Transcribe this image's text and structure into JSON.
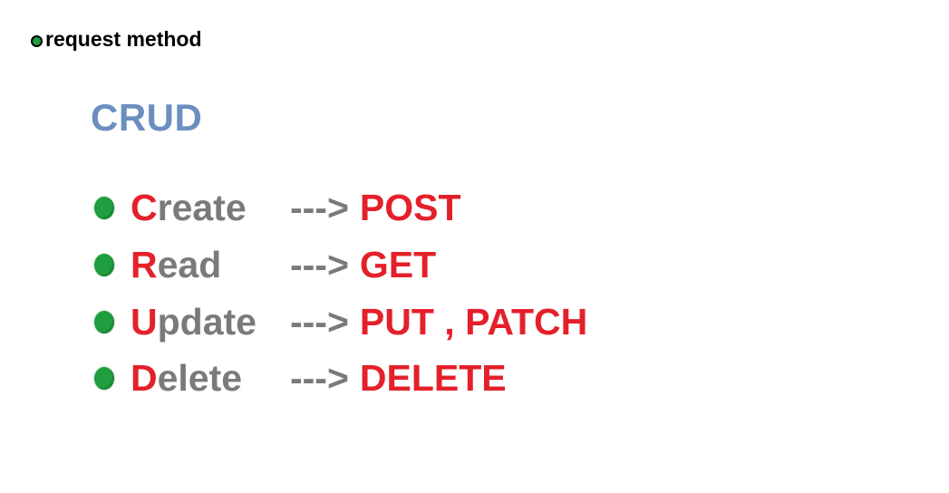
{
  "header": {
    "text": "request method"
  },
  "title": "CRUD",
  "colors": {
    "title": "#6b8fbf",
    "accent_red": "#e4202a",
    "text_gray": "#7a7a7a",
    "bullet_green": "#1f9e3f"
  },
  "rows": [
    {
      "initial": "C",
      "rest": "reate",
      "arrow": "--->",
      "method": "POST"
    },
    {
      "initial": "R",
      "rest": "ead",
      "arrow": "--->",
      "method": "GET"
    },
    {
      "initial": "U",
      "rest": "pdate",
      "arrow": "--->",
      "method": "PUT , PATCH"
    },
    {
      "initial": "D",
      "rest": "elete",
      "arrow": "--->",
      "method": "DELETE"
    }
  ]
}
